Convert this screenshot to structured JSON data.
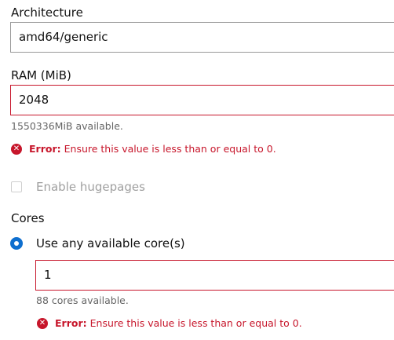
{
  "architecture": {
    "label": "Architecture",
    "value": "amd64/generic"
  },
  "ram": {
    "label": "RAM (MiB)",
    "value": "2048",
    "help": "1550336MiB available.",
    "error_title": "Error:",
    "error_message": "Ensure this value is less than or equal to 0."
  },
  "hugepages": {
    "label": "Enable hugepages",
    "checked": false,
    "disabled": true
  },
  "cores": {
    "label": "Cores",
    "option_label": "Use any available core(s)",
    "value": "1",
    "help": "88 cores available.",
    "error_title": "Error:",
    "error_message": "Ensure this value is less than or equal to 0."
  },
  "colors": {
    "error": "#c7162b",
    "accent": "#0e6fcf"
  },
  "icons": {
    "error": "error-icon",
    "radio": "radio-selected-icon",
    "checkbox": "checkbox-icon"
  }
}
